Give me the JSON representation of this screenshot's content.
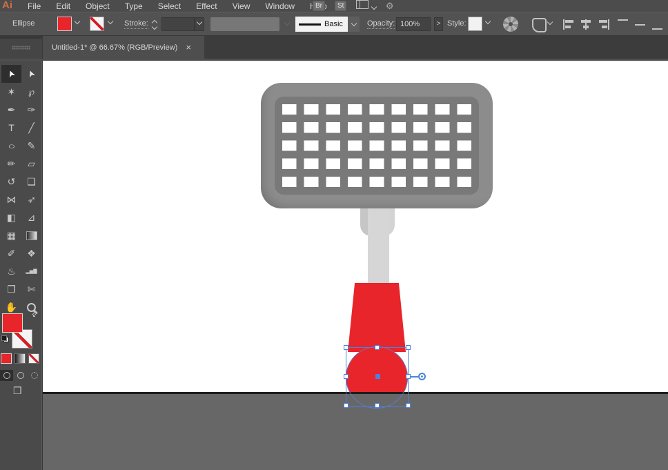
{
  "app": {
    "logo": "Ai",
    "menus": [
      "File",
      "Edit",
      "Object",
      "Type",
      "Select",
      "Effect",
      "View",
      "Window",
      "Help"
    ],
    "bridge_button": "Br",
    "stock_button": "St"
  },
  "control_bar": {
    "tool_name": "Ellipse",
    "stroke_label": "Stroke:",
    "brush_name": "Basic",
    "opacity_label": "Opacity:",
    "opacity_value": "100%",
    "opacity_more": ">",
    "style_label": "Style:"
  },
  "document_tab": {
    "title": "Untitled-1* @ 66.67% (RGB/Preview)",
    "close_glyph": "×"
  },
  "toolbar": {
    "tools": [
      {
        "name": "selection-tool",
        "glyph": "➤"
      },
      {
        "name": "direct-selection-tool",
        "glyph": "➤"
      },
      {
        "name": "magic-wand-tool",
        "glyph": "✶"
      },
      {
        "name": "lasso-tool",
        "glyph": "℘"
      },
      {
        "name": "pen-tool",
        "glyph": "✒"
      },
      {
        "name": "curvature-tool",
        "glyph": "✑"
      },
      {
        "name": "type-tool",
        "glyph": "T"
      },
      {
        "name": "line-segment-tool",
        "glyph": "╱"
      },
      {
        "name": "ellipse-tool",
        "glyph": "○"
      },
      {
        "name": "paintbrush-tool",
        "glyph": "✎"
      },
      {
        "name": "shaper-tool",
        "glyph": "✏"
      },
      {
        "name": "eraser-tool",
        "glyph": "▱"
      },
      {
        "name": "rotate-tool",
        "glyph": "↺"
      },
      {
        "name": "scale-tool",
        "glyph": "❏"
      },
      {
        "name": "width-tool",
        "glyph": "⋈"
      },
      {
        "name": "puppet-warp-tool",
        "glyph": "➳"
      },
      {
        "name": "shape-builder-tool",
        "glyph": "◧"
      },
      {
        "name": "perspective-grid-tool",
        "glyph": "⊿"
      },
      {
        "name": "mesh-tool",
        "glyph": "▦"
      },
      {
        "name": "gradient-tool",
        "glyph": ""
      },
      {
        "name": "eyedropper-tool",
        "glyph": "✐"
      },
      {
        "name": "blend-tool",
        "glyph": "❖"
      },
      {
        "name": "symbol-sprayer-tool",
        "glyph": "♨"
      },
      {
        "name": "column-graph-tool",
        "glyph": "▂▅▇"
      },
      {
        "name": "artboard-tool",
        "glyph": "❐"
      },
      {
        "name": "slice-tool",
        "glyph": "✄"
      },
      {
        "name": "hand-tool",
        "glyph": "✋"
      },
      {
        "name": "zoom-tool",
        "glyph": ""
      }
    ],
    "swap_glyph": "⇄",
    "screen_mode_glyph": "❐"
  },
  "align_icons": [
    {
      "name": "horizontal-align-left-icon",
      "cls": "h al-hl"
    },
    {
      "name": "horizontal-align-center-icon",
      "cls": "h al-hc"
    },
    {
      "name": "horizontal-align-right-icon",
      "cls": "h al-hr"
    },
    {
      "name": "vertical-align-top-icon",
      "cls": "v al-vt"
    },
    {
      "name": "vertical-align-center-icon",
      "cls": "v al-vc"
    },
    {
      "name": "vertical-align-bottom-icon",
      "cls": "v al-vb"
    }
  ],
  "colors": {
    "fill_red": "#E8252B",
    "selection_blue": "#4A82E0",
    "head_gray": "#8C8C8C",
    "grid_bar_gray": "#797979",
    "shaft_gray": "#D6D6D6",
    "ground_gray": "#676767"
  },
  "artwork": {
    "description": "flat potato-masher / grill-press illustration",
    "selected_shape": "ellipse knob at handle end"
  }
}
